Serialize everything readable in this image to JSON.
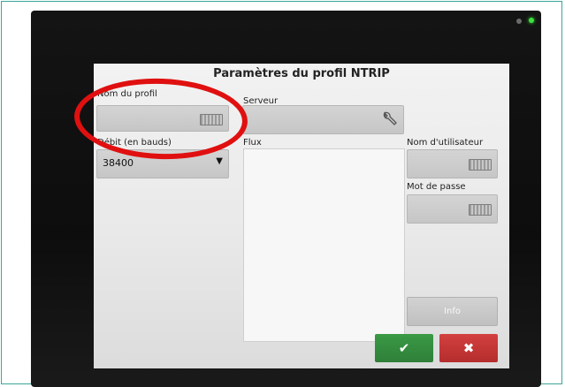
{
  "dialog": {
    "title": "Paramètres du profil NTRIP",
    "profile_name": {
      "label": "Nom du profil",
      "value": ""
    },
    "server": {
      "label": "Serveur",
      "value": ""
    },
    "baud_rate": {
      "label": "Débit (en bauds)",
      "selected": "38400",
      "arrow": "▼"
    },
    "stream": {
      "label": "Flux",
      "items": []
    },
    "username": {
      "label": "Nom d'utilisateur",
      "value": ""
    },
    "password": {
      "label": "Mot de passe",
      "value": ""
    },
    "info_button": "Info",
    "ok_glyph": "✔",
    "cancel_glyph": "✖"
  },
  "icons": {
    "keyboard": "keyboard-icon",
    "wrench": "wrench-icon"
  },
  "colors": {
    "ok": "#2f8a3b",
    "cancel": "#c43535",
    "annotation": "#e01010",
    "status_led": "#39e33a"
  }
}
